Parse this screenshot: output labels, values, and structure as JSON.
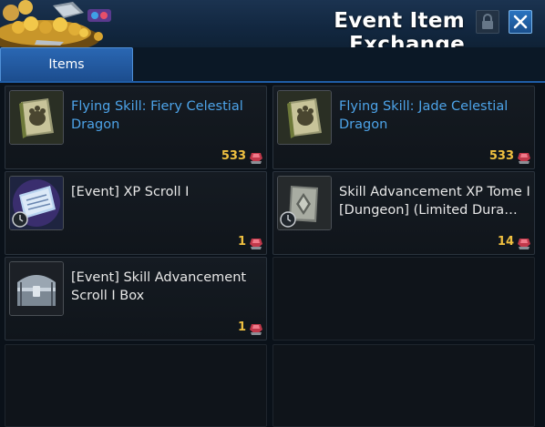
{
  "window": {
    "title": "Event Item Exchange"
  },
  "tabs": [
    {
      "label": "Items",
      "selected": true
    }
  ],
  "items": [
    {
      "name": "Flying Skill: Fiery Celestial Dragon",
      "price": "533",
      "name_color": "#4da3e8",
      "icon": "skill-book-icon",
      "timed": false
    },
    {
      "name": "Flying Skill: Jade Celestial Dragon",
      "price": "533",
      "name_color": "#4da3e8",
      "icon": "skill-book-icon",
      "timed": false
    },
    {
      "name": "[Event] XP Scroll I",
      "price": "1",
      "name_color": "#e8e8e8",
      "icon": "scroll-icon",
      "timed": true
    },
    {
      "name": "Skill Advancement XP Tome I [Dungeon] (Limited Dura…",
      "price": "14",
      "name_color": "#e8e8e8",
      "icon": "tome-icon",
      "timed": true
    },
    {
      "name": "[Event] Skill Advancement Scroll I Box",
      "price": "1",
      "name_color": "#e8e8e8",
      "icon": "chest-icon",
      "timed": false
    }
  ],
  "colors": {
    "accent": "#2a67b3",
    "price": "#f0c040",
    "currency": "#c0384a"
  }
}
